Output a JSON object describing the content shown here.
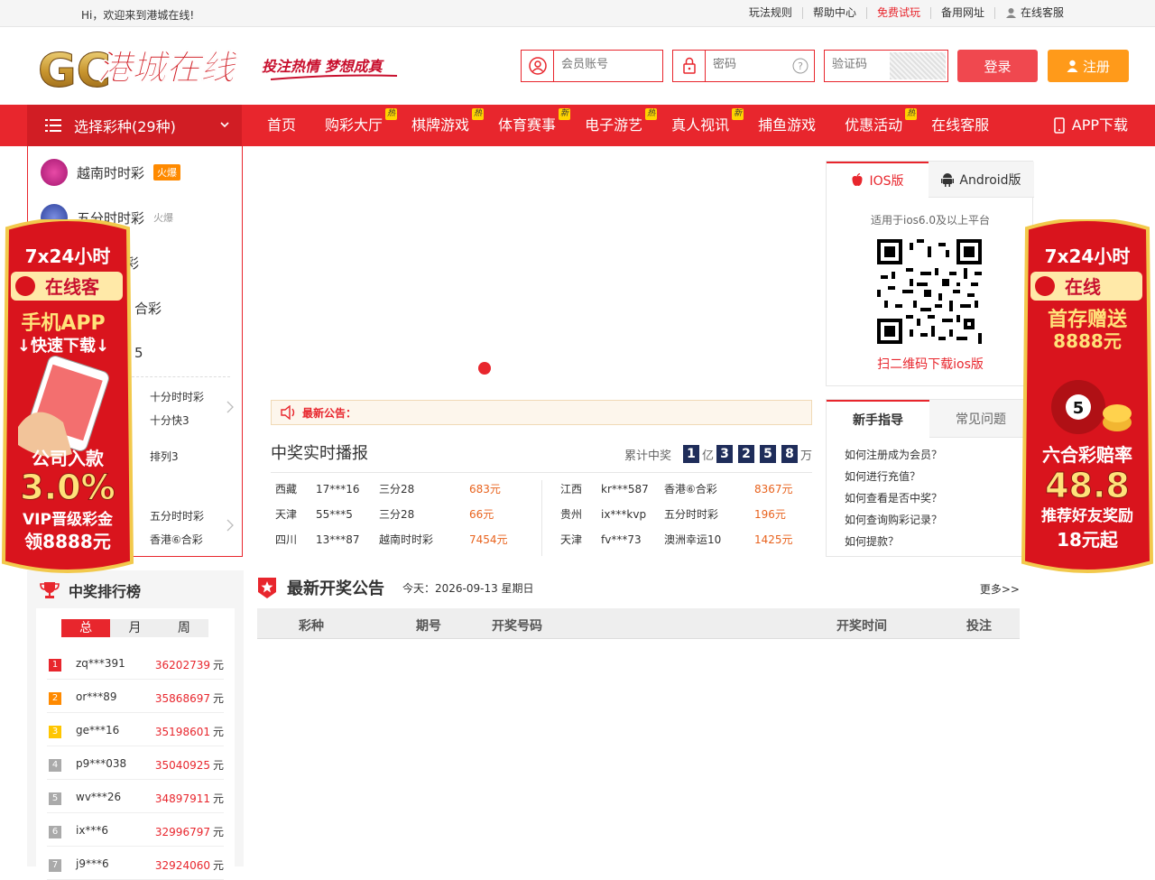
{
  "topbar": {
    "welcome": "Hi，欢迎来到港城在线!",
    "links": [
      "玩法规则",
      "帮助中心",
      "免费试玩",
      "备用网址",
      "在线客服"
    ]
  },
  "header": {
    "logo_letters": "GC",
    "logo_text": "港城在线",
    "slogan": "投注热情 梦想成真",
    "account_placeholder": "会员账号",
    "password_placeholder": "密码",
    "captcha_placeholder": "验证码",
    "login_label": "登录",
    "register_label": "注册"
  },
  "nav": {
    "category_label": "选择彩种(29种)",
    "items": [
      {
        "label": "首页",
        "tag": ""
      },
      {
        "label": "购彩大厅",
        "tag": "热"
      },
      {
        "label": "棋牌游戏",
        "tag": "热"
      },
      {
        "label": "体育赛事",
        "tag": "新"
      },
      {
        "label": "电子游艺",
        "tag": "热"
      },
      {
        "label": "真人视讯",
        "tag": "新"
      },
      {
        "label": "捕鱼游戏",
        "tag": ""
      },
      {
        "label": "优惠活动",
        "tag": "热"
      },
      {
        "label": "在线客服",
        "tag": ""
      }
    ],
    "app_label": "APP下载"
  },
  "sidemenu": {
    "lotteries": [
      {
        "name": "越南时时彩",
        "badge": "火爆"
      },
      {
        "name": "五分时时彩",
        "badge": "火爆"
      },
      {
        "name": "彩",
        "badge": ""
      },
      {
        "name": "合彩",
        "badge": ""
      },
      {
        "name": "5",
        "badge": ""
      }
    ],
    "sub_a": [
      "十分时时彩",
      "十分快3",
      "排列3"
    ],
    "sub_b": [
      "五分时时彩",
      "香港⑥合彩"
    ]
  },
  "notice": {
    "label": "最新公告："
  },
  "live": {
    "title": "中奖实时播报",
    "total_label": "累计中奖",
    "digits": [
      "1",
      "3",
      "2",
      "5",
      "8"
    ],
    "unit_yi": "亿",
    "unit_wan": "万",
    "rows_left": [
      {
        "region": "西藏",
        "user": "17***16",
        "game": "三分28",
        "amount": "683元"
      },
      {
        "region": "天津",
        "user": "55***5",
        "game": "三分28",
        "amount": "66元"
      },
      {
        "region": "四川",
        "user": "13***87",
        "game": "越南时时彩",
        "amount": "7454元"
      }
    ],
    "rows_right": [
      {
        "region": "江西",
        "user": "kr***587",
        "game": "香港⑥合彩",
        "amount": "8367元"
      },
      {
        "region": "贵州",
        "user": "ix***kvp",
        "game": "五分时时彩",
        "amount": "196元"
      },
      {
        "region": "天津",
        "user": "fv***73",
        "game": "澳洲幸运10",
        "amount": "1425元"
      }
    ]
  },
  "download": {
    "tab_ios": "IOS版",
    "tab_android": "Android版",
    "hint": "适用于ios6.0及以上平台",
    "scan_label": "扫二维码下载ios版"
  },
  "guide": {
    "tab_new": "新手指导",
    "tab_faq": "常见问题",
    "questions": [
      "如何注册成为会员？",
      "如何进行充值？",
      "如何查看是否中奖？",
      "如何查询购彩记录？",
      "如何提款？"
    ]
  },
  "ranking": {
    "title": "中奖排行榜",
    "tabs": [
      "总",
      "月",
      "周"
    ],
    "unit": "元",
    "rows": [
      {
        "rank": "1",
        "user": "zq***391",
        "amount": "36202739"
      },
      {
        "rank": "2",
        "user": "or***89",
        "amount": "35868697"
      },
      {
        "rank": "3",
        "user": "ge***16",
        "amount": "35198601"
      },
      {
        "rank": "4",
        "user": "p9***038",
        "amount": "35040925"
      },
      {
        "rank": "5",
        "user": "wv***26",
        "amount": "34897911"
      },
      {
        "rank": "6",
        "user": "ix***6",
        "amount": "32996797"
      },
      {
        "rank": "7",
        "user": "j9***6",
        "amount": "32924060"
      }
    ]
  },
  "draws": {
    "title": "最新开奖公告",
    "date": "今天：2026-09-13 星期日",
    "more": "更多>>",
    "columns": [
      "彩种",
      "期号",
      "开奖号码",
      "开奖时间",
      "投注"
    ]
  },
  "float_left": {
    "l1": "7x24小时",
    "l2": "在线客",
    "l3": "手机APP",
    "l4": "↓快速下载↓",
    "l5": "公司入款",
    "l6": "3.0%",
    "l7": "VIP晋级彩金",
    "l8": "领8888元"
  },
  "float_right": {
    "l1": "7x24小时",
    "l2": "在线",
    "l3": "首存赠送",
    "l4": "8888元",
    "l5": "六合彩赔率",
    "l6": "48.8",
    "l7": "推荐好友奖励",
    "l8": "18元起"
  },
  "colors": {
    "brand_red": "#e8262d",
    "orange": "#ff8a00",
    "navy_digit": "#1f2d5a"
  }
}
